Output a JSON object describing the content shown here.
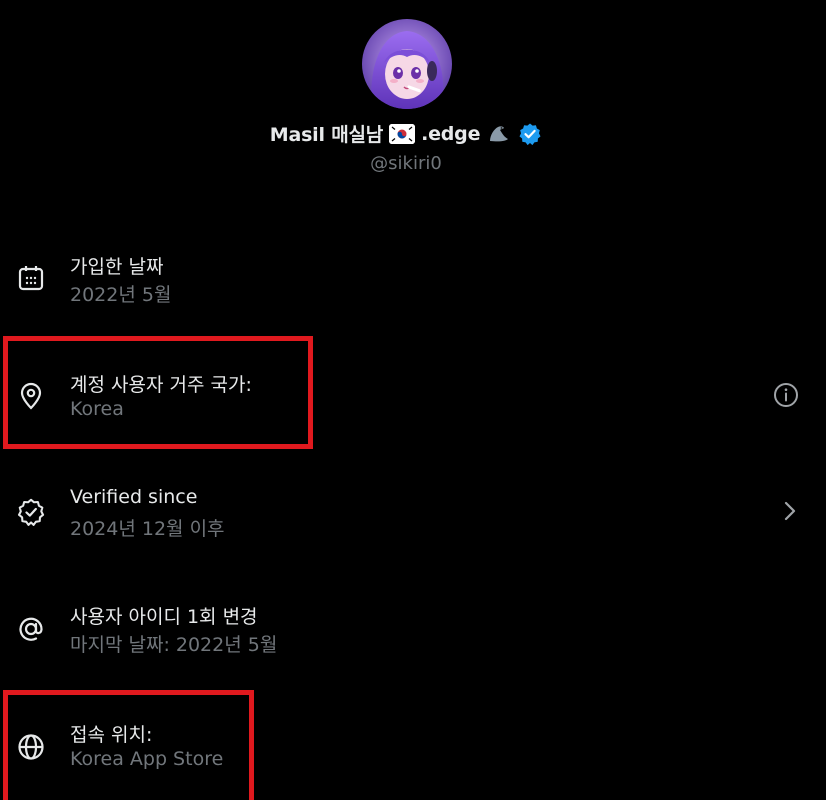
{
  "profile": {
    "display_name": "Masil 매실남",
    "name_suffix": ".edge",
    "handle": "@sikiri0",
    "verified_color": "#1d9bf0",
    "avatar_icon": "anime-avatar",
    "flag_icon": "south-korea-flag-icon",
    "emoji_icon": "seal-icon"
  },
  "rows": {
    "joined": {
      "title": "가입한 날짜",
      "value": "2022년 5월",
      "icon": "calendar-icon"
    },
    "country": {
      "title": "계정 사용자 거주 국가:",
      "value": "Korea",
      "icon": "location-pin-icon",
      "trailing_icon": "info-icon"
    },
    "verified": {
      "title": "Verified since",
      "value": "2024년 12월 이후",
      "icon": "verified-check-icon",
      "trailing_icon": "chevron-right-icon"
    },
    "username": {
      "title": "사용자 아이디 1회 변경",
      "value": "마지막 날짜: 2022년 5월",
      "icon": "at-sign-icon"
    },
    "connected": {
      "title": "접속 위치:",
      "value": "Korea App Store",
      "icon": "globe-icon"
    }
  },
  "colors": {
    "background": "#000000",
    "primary_text": "#e7e9ea",
    "secondary_text": "#71767b",
    "highlight_box": "#e0191e"
  }
}
